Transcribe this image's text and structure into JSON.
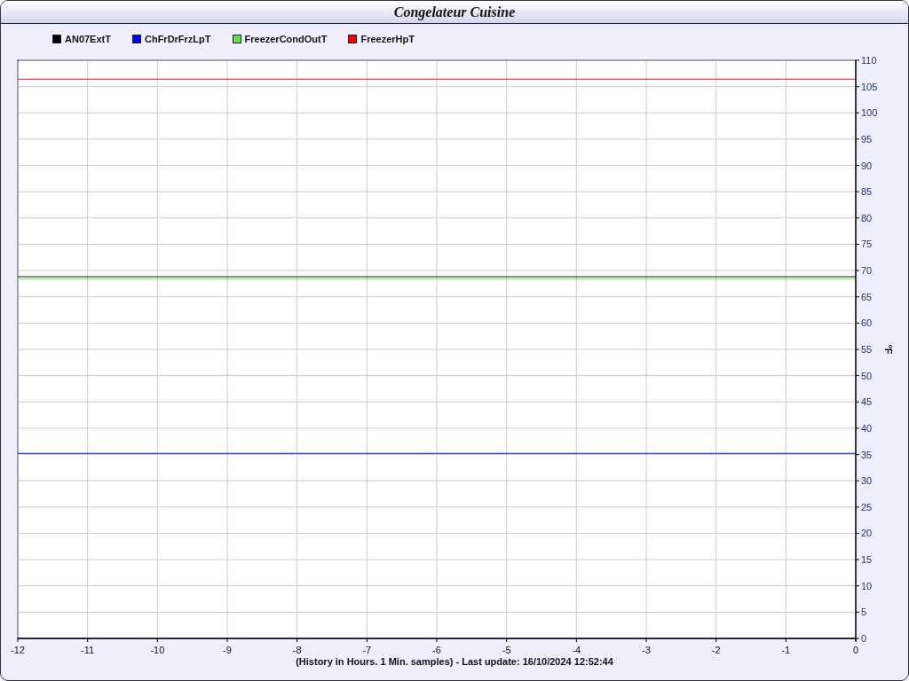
{
  "window": {
    "title": "Congelateur Cuisine"
  },
  "chart": {
    "chart_data": {
      "type": "line",
      "xlabel": "(History in Hours. 1 Min. samples) - Last update: 16/10/2024 12:52:44",
      "ylabel": "°F",
      "x": [
        -12,
        0
      ],
      "series": [
        {
          "name": "AN07ExtT",
          "color": "#000000",
          "values": [
            68.8,
            68.8
          ]
        },
        {
          "name": "ChFrDrFrzLpT",
          "color": "#0000ff",
          "values": [
            35.2,
            35.2
          ]
        },
        {
          "name": "FreezerCondOutT",
          "color": "#66dd44",
          "values": [
            68.4,
            68.4
          ]
        },
        {
          "name": "FreezerHpT",
          "color": "#ff0000",
          "values": [
            106.4,
            106.4
          ]
        }
      ],
      "xlim": [
        -12,
        0
      ],
      "ylim": [
        0,
        110
      ],
      "grid": true,
      "xticks": [
        -12,
        -11,
        -10,
        -9,
        -8,
        -7,
        -6,
        -5,
        -4,
        -3,
        -2,
        -1,
        0
      ],
      "yticks": [
        0,
        5,
        10,
        15,
        20,
        25,
        30,
        35,
        40,
        45,
        50,
        55,
        60,
        65,
        70,
        75,
        80,
        85,
        90,
        95,
        100,
        105,
        110
      ]
    }
  }
}
